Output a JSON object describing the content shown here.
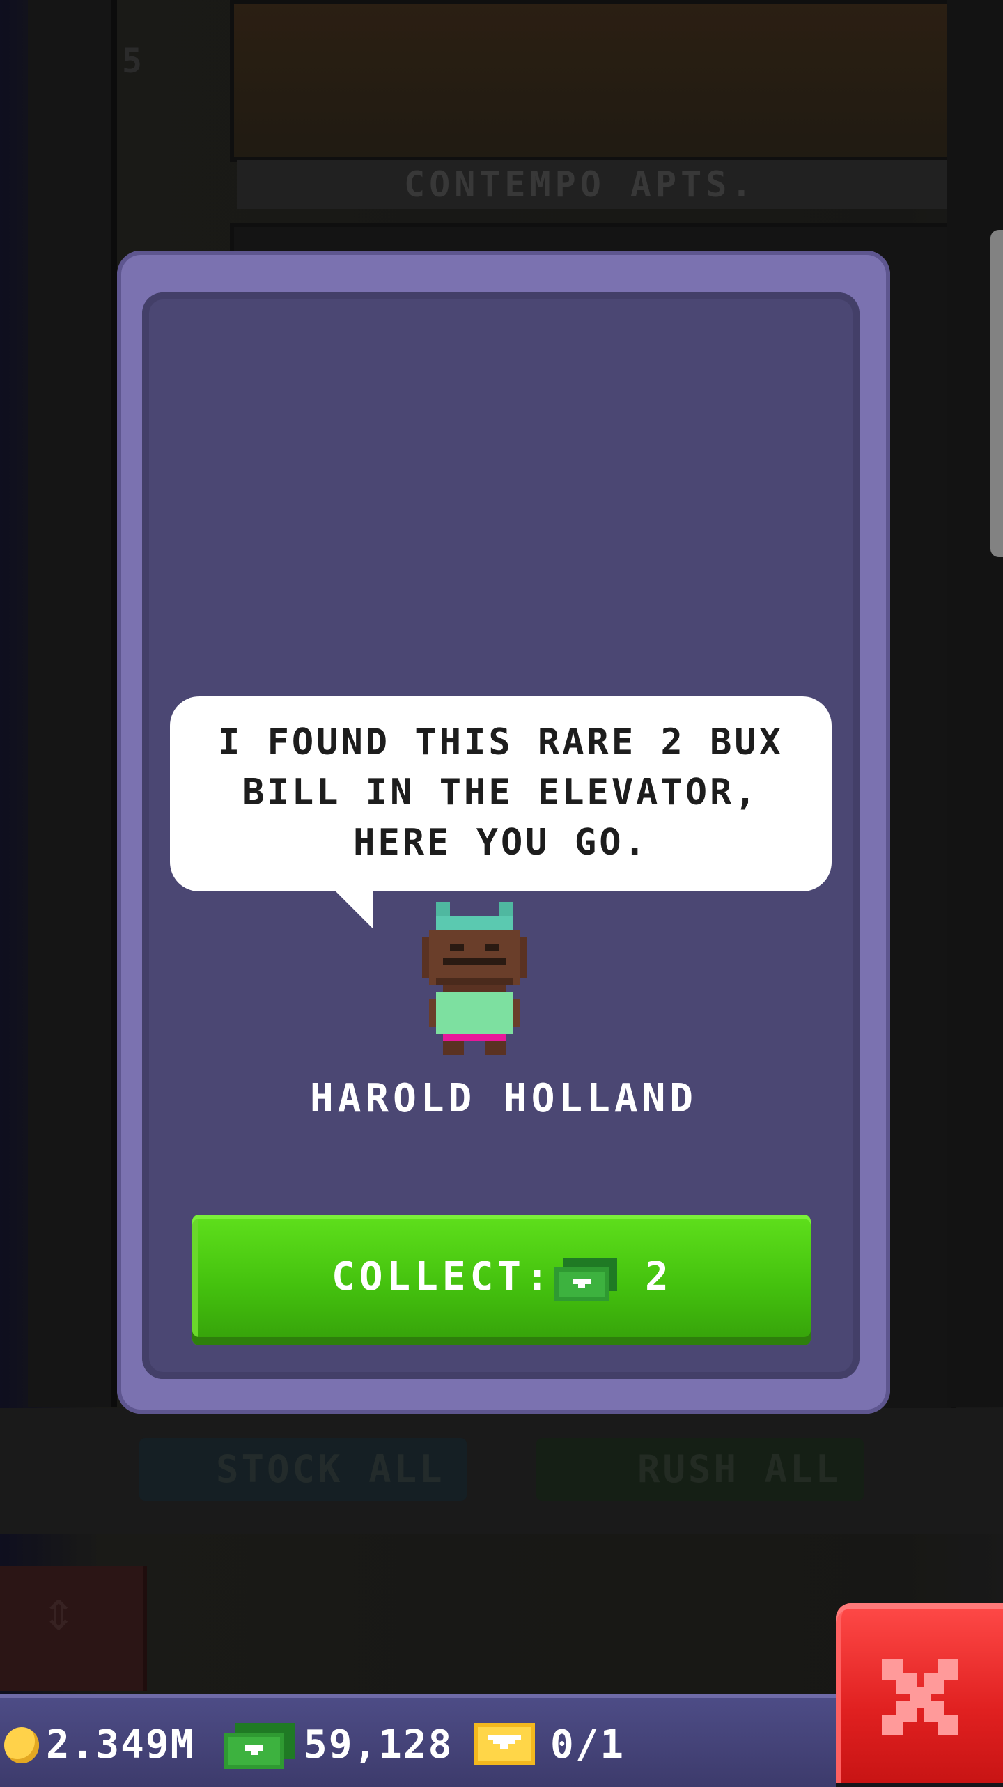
{
  "background": {
    "floor_number": "5",
    "floor_label": "CONTEMPO APTS.",
    "stock_all_label": "STOCK ALL",
    "rush_all_label": "RUSH ALL"
  },
  "modal": {
    "speech": "I FOUND THIS RARE 2 BUX BILL IN THE ELEVATOR, HERE YOU GO.",
    "character_name": "HAROLD HOLLAND",
    "collect_label": "COLLECT:",
    "collect_amount": "2",
    "collect_icon": "bux-bill-icon"
  },
  "hud": {
    "coins": "2.349M",
    "bux": "59,128",
    "tickets": "0/1",
    "coin_icon": "coin-icon",
    "bux_icon": "bux-bill-icon",
    "ticket_icon": "golden-ticket-icon"
  },
  "close_icon": "close-icon",
  "colors": {
    "modal_frame": "#7b72b0",
    "modal_inner": "#4b4773",
    "collect_green": "#44c10e",
    "close_red": "#e02020",
    "hud_bar": "#4d4c86"
  }
}
